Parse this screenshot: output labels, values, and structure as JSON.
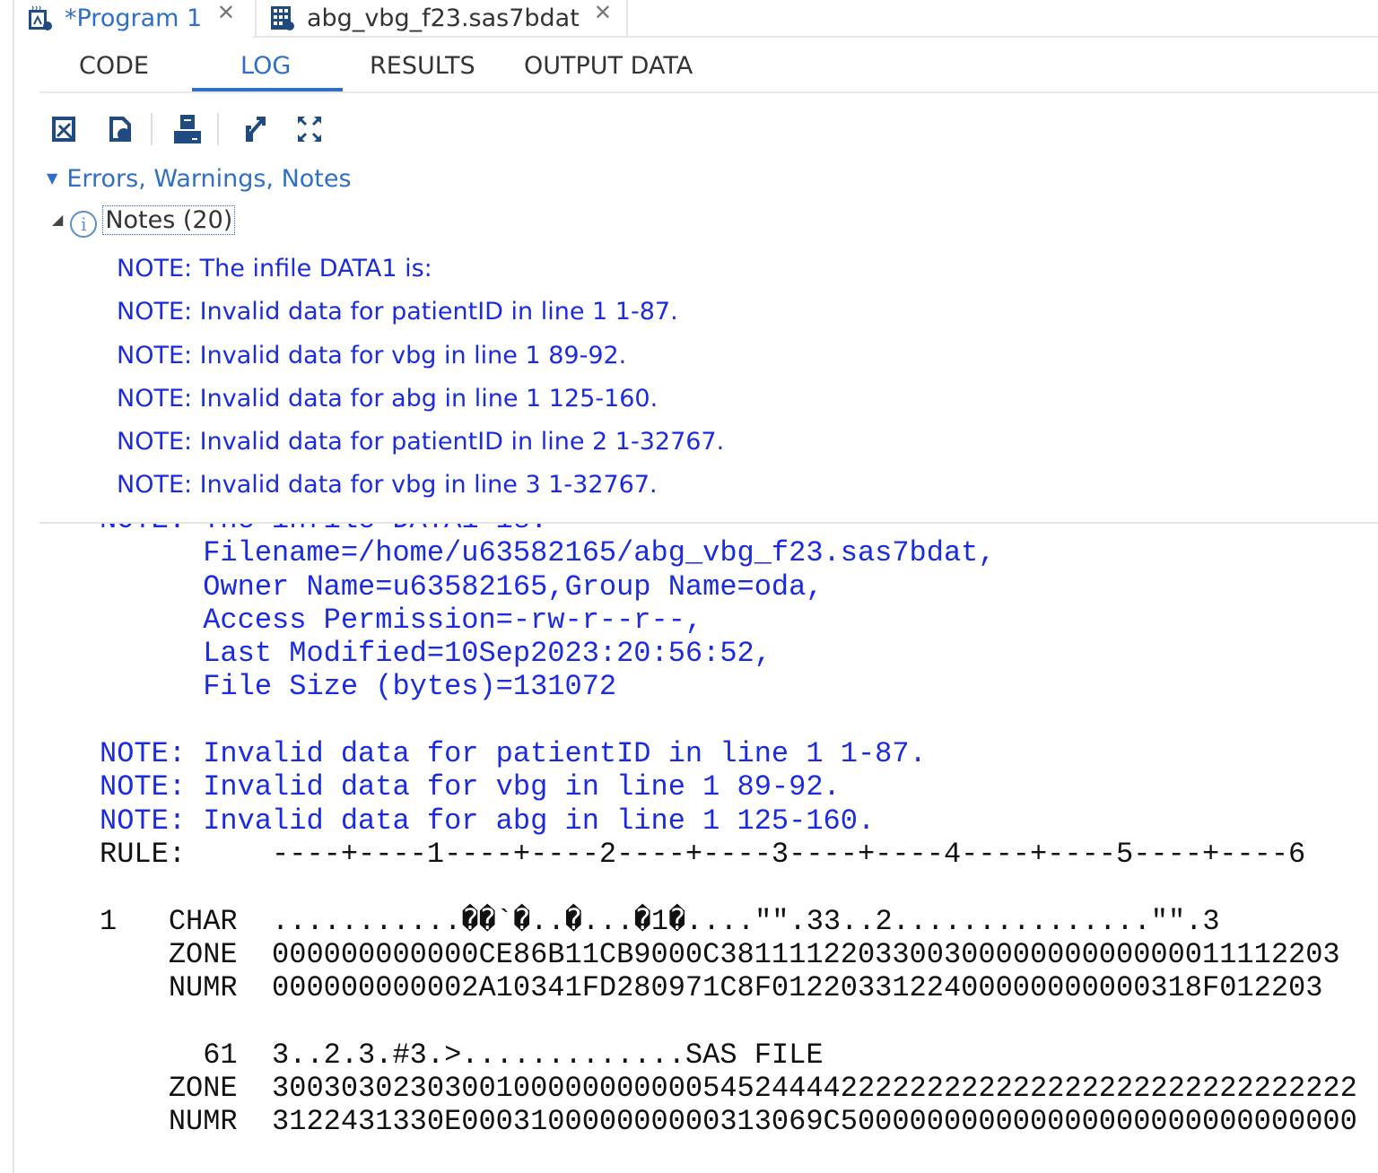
{
  "doc_tabs": [
    {
      "label": "*Program 1",
      "icon": "program-icon",
      "close": "✕"
    },
    {
      "label": "abg_vbg_f23.sas7bdat",
      "icon": "table-icon",
      "close": "✕"
    }
  ],
  "subtabs": [
    "CODE",
    "LOG",
    "RESULTS",
    "OUTPUT DATA"
  ],
  "active_subtab": "LOG",
  "toolbar": [
    "save-log-icon",
    "export-html-icon",
    "print-icon",
    "pop-out-icon",
    "maximize-icon"
  ],
  "tree": {
    "section": "Errors, Warnings, Notes",
    "notes_label": "Notes (20)",
    "notes": [
      "NOTE: The infile DATA1 is:",
      "NOTE: Invalid data for patientID in line 1 1-87.",
      "NOTE: Invalid data for vbg in line 1 89-92.",
      "NOTE: Invalid data for abg in line 1 125-160.",
      "NOTE: Invalid data for patientID in line 2 1-32767.",
      "NOTE: Invalid data for vbg in line 3 1-32767."
    ]
  },
  "log": {
    "lines": [
      "NOTE: The infile DATA1 is:",
      "      Filename=/home/u63582165/abg_vbg_f23.sas7bdat,",
      "      Owner Name=u63582165,Group Name=oda,",
      "      Access Permission=-rw-r--r--,",
      "      Last Modified=10Sep2023:20:56:52,",
      "      File Size (bytes)=131072",
      "",
      "NOTE: Invalid data for patientID in line 1 1-87.",
      "NOTE: Invalid data for vbg in line 1 89-92.",
      "NOTE: Invalid data for abg in line 1 125-160."
    ],
    "dump": [
      "RULE:     ----+----1----+----2----+----3----+----4----+----5----+----6",
      "",
      "1   CHAR  ...........��`�..�...�1�....\"\".33..2...............\"\".3",
      "    ZONE  000000000000CE86B11CB9000C381111220330030000000000000011112203",
      "    NUMR  000000000002A10341FD280971C8F0122033122400000000000318F012203",
      "",
      "      61  3..2.3.#3.>.............SAS FILE",
      "    ZONE  300303023030010000000000054524444222222222222222222222222222222",
      "    NUMR  3122431330E000310000000000313069C500000000000000000000000000000"
    ]
  },
  "colors": {
    "accent": "#2f6fc4",
    "note_blue": "#1a2be0"
  }
}
